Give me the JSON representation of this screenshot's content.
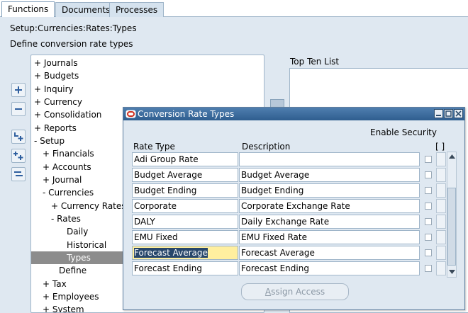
{
  "tabs": [
    {
      "label": "Functions",
      "active": true
    },
    {
      "label": "Documents",
      "active": false
    },
    {
      "label": "Processes",
      "active": false
    }
  ],
  "breadcrumb": "Setup:Currencies:Rates:Types",
  "description": "Define conversion rate types",
  "tree": [
    {
      "label": "+  Journals"
    },
    {
      "label": "+  Budgets"
    },
    {
      "label": "+  Inquiry"
    },
    {
      "label": "+  Currency"
    },
    {
      "label": "+  Consolidation"
    },
    {
      "label": "+  Reports"
    },
    {
      "label": "-  Setup"
    },
    {
      "label": "+  Financials"
    },
    {
      "label": "+  Accounts"
    },
    {
      "label": "+  Journal"
    },
    {
      "label": "-  Currencies"
    },
    {
      "label": "+  Currency Rates M"
    },
    {
      "label": "-  Rates"
    },
    {
      "label": "Daily"
    },
    {
      "label": "Historical"
    },
    {
      "label": "Types",
      "selected": true
    },
    {
      "label": "Define"
    },
    {
      "label": "+  Tax"
    },
    {
      "label": "+  Employees"
    },
    {
      "label": "+  System"
    }
  ],
  "top_ten": {
    "label": "Top Ten List"
  },
  "dialog": {
    "title": "Conversion Rate Types",
    "enable_security": "Enable Security",
    "col_rate_type": "Rate Type",
    "col_description": "Description",
    "col_bracket": "[ ]",
    "rows": [
      {
        "rate_type": "Adi Group Rate",
        "description": ""
      },
      {
        "rate_type": "Budget Average",
        "description": "Budget Average"
      },
      {
        "rate_type": "Budget Ending",
        "description": "Budget Ending"
      },
      {
        "rate_type": "Corporate",
        "description": "Corporate Exchange Rate"
      },
      {
        "rate_type": "DALY",
        "description": "Daily Exchange Rate"
      },
      {
        "rate_type": "EMU Fixed",
        "description": "EMU Fixed Rate"
      },
      {
        "rate_type": "Forecast Average",
        "description": "Forecast Average",
        "active": true
      },
      {
        "rate_type": "Forecast Ending",
        "description": "Forecast Ending"
      }
    ],
    "assign_access": {
      "underline": "A",
      "rest": "ssign Access"
    }
  },
  "icons": {
    "add": "plus-icon",
    "remove": "minus-icon",
    "expand": "expand-branch-icon",
    "expand_all": "expand-all-icon",
    "collapse_all": "collapse-all-icon",
    "oracle": "oracle-logo-icon"
  },
  "colors": {
    "titlebar": "#3a6a9b",
    "panel": "#dfe8f1",
    "selected_row": "#8c8c8c",
    "active_field": "#ffef9f"
  }
}
